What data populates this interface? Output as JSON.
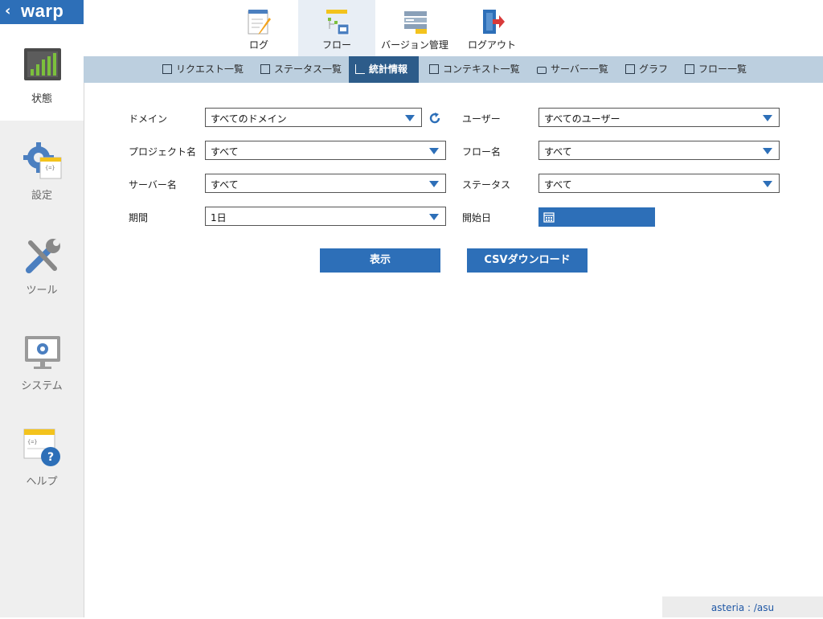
{
  "brand": {
    "name": "warp",
    "back_icon": "chevron-left-icon"
  },
  "sidebar": {
    "items": [
      {
        "label": "状態",
        "icon": "status-chart-icon",
        "active": true
      },
      {
        "label": "設定",
        "icon": "settings-gear-icon",
        "active": false
      },
      {
        "label": "ツール",
        "icon": "tools-icon",
        "active": false
      },
      {
        "label": "システム",
        "icon": "system-monitor-icon",
        "active": false
      },
      {
        "label": "ヘルプ",
        "icon": "help-icon",
        "active": false
      }
    ]
  },
  "topnav": {
    "items": [
      {
        "label": "ログ",
        "icon": "log-notepad-icon",
        "active": false
      },
      {
        "label": "フロー",
        "icon": "flow-icon",
        "active": true
      },
      {
        "label": "バージョン管理",
        "icon": "version-control-icon",
        "active": false
      },
      {
        "label": "ログアウト",
        "icon": "logout-door-icon",
        "active": false
      }
    ]
  },
  "subnav": {
    "items": [
      {
        "label": "リクエスト一覧",
        "icon": "request-list-icon",
        "active": false
      },
      {
        "label": "ステータス一覧",
        "icon": "status-list-icon",
        "active": false
      },
      {
        "label": "統計情報",
        "icon": "statistics-icon",
        "active": true
      },
      {
        "label": "コンテキスト一覧",
        "icon": "context-list-icon",
        "active": false
      },
      {
        "label": "サーバー一覧",
        "icon": "server-list-icon",
        "active": false
      },
      {
        "label": "グラフ",
        "icon": "graph-icon",
        "active": false
      },
      {
        "label": "フロー一覧",
        "icon": "flow-list-icon",
        "active": false
      }
    ]
  },
  "form": {
    "domain": {
      "label": "ドメイン",
      "value": "すべてのドメイン"
    },
    "user": {
      "label": "ユーザー",
      "value": "すべてのユーザー"
    },
    "project": {
      "label": "プロジェクト名",
      "value": "すべて"
    },
    "flow": {
      "label": "フロー名",
      "value": "すべて"
    },
    "server": {
      "label": "サーバー名",
      "value": "すべて"
    },
    "status": {
      "label": "ステータス",
      "value": "すべて"
    },
    "period": {
      "label": "期間",
      "value": "1日"
    },
    "start_date": {
      "label": "開始日",
      "value": ""
    }
  },
  "buttons": {
    "show": "表示",
    "csv": "CSVダウンロード"
  },
  "footer": {
    "status_text": "asteria : /asu"
  },
  "colors": {
    "accent": "#2d6fb8",
    "subnav_bg": "#bccfdf",
    "subnav_active": "#2d5c8a",
    "sidebar_bg": "#efefef"
  }
}
